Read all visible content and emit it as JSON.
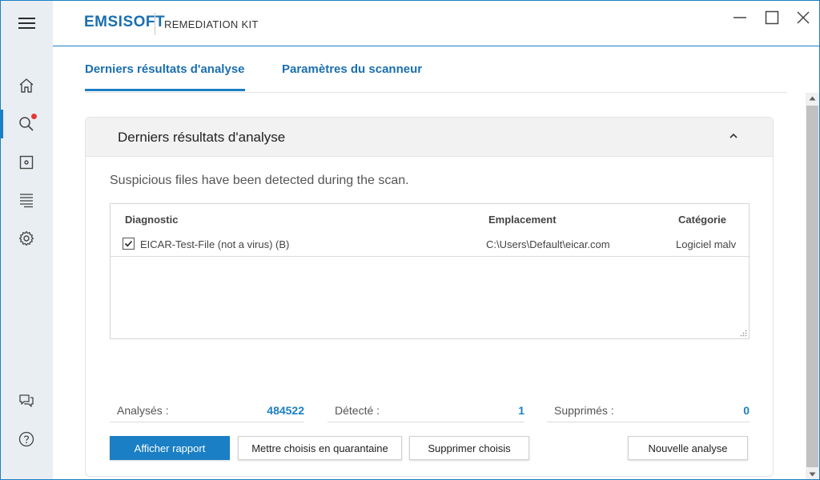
{
  "titlebar": {
    "brand": "EMSISOFT",
    "product": "REMEDIATION KIT",
    "menu_icon": "hamburger-icon",
    "window_controls": [
      "minimize-icon",
      "maximize-icon",
      "close-icon"
    ]
  },
  "sidebar": {
    "items": [
      {
        "icon": "home-icon",
        "active": false
      },
      {
        "icon": "search-icon",
        "active": true,
        "notification": true
      },
      {
        "icon": "quarantine-icon",
        "active": false
      },
      {
        "icon": "logs-icon",
        "active": false
      },
      {
        "icon": "settings-icon",
        "active": false
      },
      {
        "icon": "chat-icon",
        "active": false
      },
      {
        "icon": "help-icon",
        "active": false
      }
    ]
  },
  "tabs": [
    {
      "label": "Derniers résultats d'analyse",
      "active": true
    },
    {
      "label": "Paramètres du scanneur",
      "active": false
    }
  ],
  "panel": {
    "title": "Derniers résultats d'analyse",
    "message": "Suspicious files have been detected during the scan.",
    "columns": {
      "diagnostic": "Diagnostic",
      "location": "Emplacement",
      "category": "Catégorie"
    },
    "rows": [
      {
        "checked": true,
        "diagnostic": "EICAR-Test-File (not a virus) (B)",
        "location": "C:\\Users\\Default\\eicar.com",
        "category": "Logiciel malv"
      }
    ],
    "stats": {
      "scanned_label": "Analysés :",
      "scanned_value": "484522",
      "detected_label": "Détecté :",
      "detected_value": "1",
      "removed_label": "Supprimés :",
      "removed_value": "0"
    },
    "buttons": {
      "report": "Afficher rapport",
      "quarantine": "Mettre choisis en quarantaine",
      "delete": "Supprimer choisis",
      "new_scan": "Nouvelle analyse"
    }
  },
  "colors": {
    "accent": "#1a7fc4",
    "brand": "#1a6fb0",
    "notification": "#e53935",
    "sidebar_bg": "#e9eef2"
  }
}
